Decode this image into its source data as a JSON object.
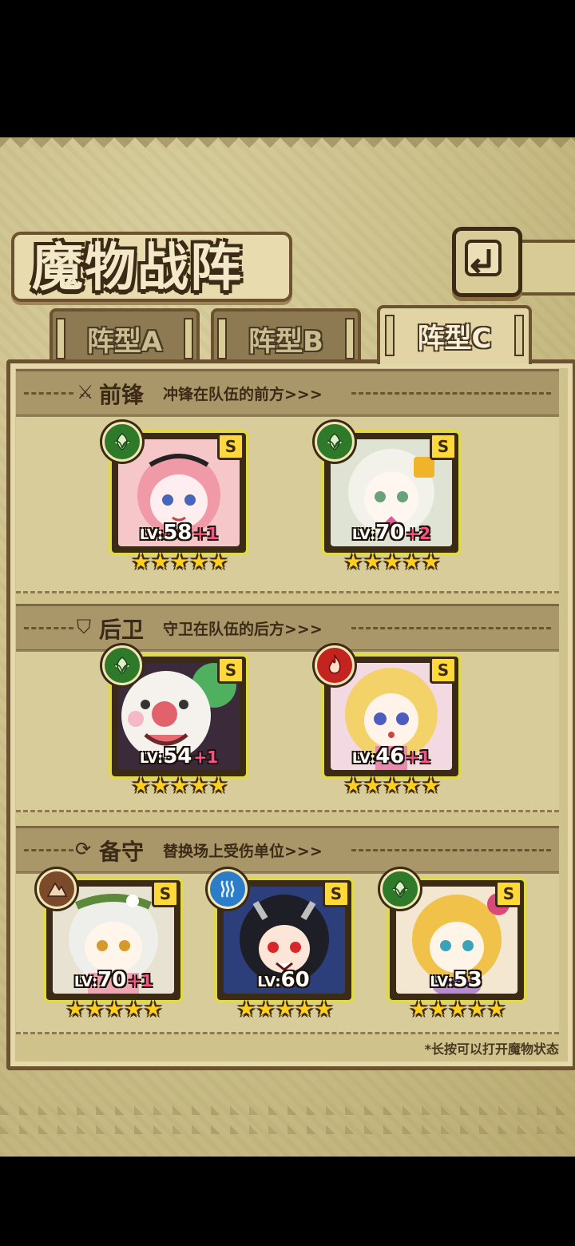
{
  "title": "魔物战阵",
  "back_icon": "back-arrow-icon",
  "tabs": [
    {
      "label": "阵型A",
      "active": false
    },
    {
      "label": "阵型B",
      "active": false
    },
    {
      "label": "阵型C",
      "active": true
    }
  ],
  "sections": [
    {
      "icon": "sword-icon",
      "title": "前锋",
      "desc": "冲锋在队伍的前方>>>"
    },
    {
      "icon": "shield-icon",
      "title": "后卫",
      "desc": "守卫在队伍的后方>>>"
    },
    {
      "icon": "swap-icon",
      "title": "备守",
      "desc": "替换场上受伤单位>>>"
    }
  ],
  "front": [
    {
      "element": "grass-icon",
      "rank": "S",
      "lv_prefix": "LV:",
      "level": "58",
      "plus": "+1",
      "stars": 5
    },
    {
      "element": "grass-icon",
      "rank": "S",
      "lv_prefix": "LV:",
      "level": "70",
      "plus": "+2",
      "stars": 5
    }
  ],
  "back": [
    {
      "element": "grass-icon",
      "rank": "S",
      "lv_prefix": "LV:",
      "level": "54",
      "plus": "+1",
      "stars": 5
    },
    {
      "element": "fire-icon",
      "rank": "S",
      "lv_prefix": "LV:",
      "level": "46",
      "plus": "+1",
      "stars": 5
    }
  ],
  "reserve": [
    {
      "element": "earth-icon",
      "rank": "S",
      "lv_prefix": "LV:",
      "level": "70",
      "plus": "+1",
      "stars": 5
    },
    {
      "element": "water-icon",
      "rank": "S",
      "lv_prefix": "LV:",
      "level": "60",
      "plus": "",
      "stars": 5
    },
    {
      "element": "grass-icon",
      "rank": "S",
      "lv_prefix": "LV:",
      "level": "53",
      "plus": "",
      "stars": 5
    }
  ],
  "hint": "*长按可以打开魔物状态",
  "colors": {
    "frame": "#e0d94a",
    "grass": "#2f7a2a",
    "fire": "#c3241f",
    "water": "#2b7cc9",
    "earth": "#7a4a2b",
    "plus": "#ff4f8a"
  }
}
